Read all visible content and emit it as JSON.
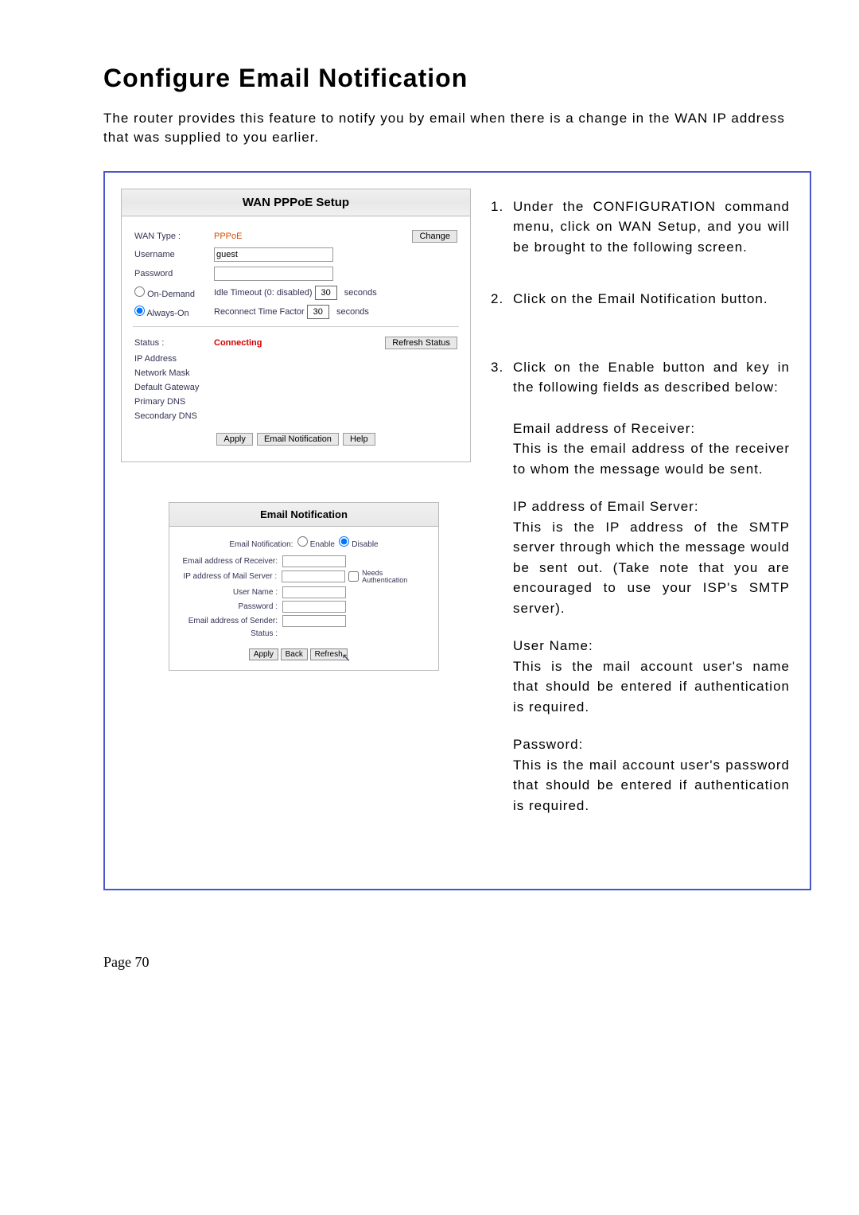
{
  "title": "Configure Email Notification",
  "intro": "The router provides this feature to notify you by email when there is a change in the WAN IP address that was supplied to you earlier.",
  "panelA": {
    "header": "WAN PPPoE Setup",
    "wanTypeLabel": "WAN Type :",
    "wanTypeValue": "PPPoE",
    "changeBtn": "Change",
    "usernameLabel": "Username",
    "usernameValue": "guest",
    "passwordLabel": "Password",
    "passwordValue": "",
    "onDemandLabel": "On-Demand",
    "alwaysOnLabel": "Always-On",
    "idleTimeoutLabel": "Idle Timeout (0: disabled)",
    "idleTimeoutValue": "30",
    "reconnectLabel": "Reconnect Time Factor",
    "reconnectValue": "30",
    "secondsLabel": "seconds",
    "statusLabel": "Status :",
    "statusValue": "Connecting",
    "refreshStatusBtn": "Refresh Status",
    "ipAddrLabel": "IP Address",
    "netmaskLabel": "Network Mask",
    "gatewayLabel": "Default Gateway",
    "primaryDnsLabel": "Primary DNS",
    "secondaryDnsLabel": "Secondary DNS",
    "applyBtn": "Apply",
    "emailNotifBtn": "Email Notification",
    "helpBtn": "Help"
  },
  "panelB": {
    "header": "Email Notification",
    "enableLabel": "Email Notification:",
    "optEnable": "Enable",
    "optDisable": "Disable",
    "receiverLabel": "Email address of Receiver:",
    "mailServerLabel": "IP address of Mail Server :",
    "needsAuthLabel": "Needs Authentication",
    "userNameLabel": "User Name :",
    "passwordLabel": "Password :",
    "senderLabel": "Email address of Sender:",
    "statusLabel": "Status :",
    "applyBtn": "Apply",
    "backBtn": "Back",
    "refreshBtn": "Refresh"
  },
  "steps": {
    "s1": "Under the CONFIGURATION command menu, click on WAN Setup, and you will be brought to the following screen.",
    "s2": "Click on the Email Notification button.",
    "s3intro": "Click on the Enable button and key in the following fields as described below:",
    "s3a_t": "Email address of Receiver:",
    "s3a_b": "This is the email address of the receiver to whom the message would be sent.",
    "s3b_t": "IP address of Email Server:",
    "s3b_b": "This is the IP address of the SMTP server through which the message would be sent out. (Take note that you are encouraged to use your ISP's SMTP server).",
    "s3c_t": "User Name:",
    "s3c_b": "This is the mail account user's name that should be entered if authentication is required.",
    "s3d_t": "Password:",
    "s3d_b": "This is the mail account user's password that should be entered if authentication is required."
  },
  "footer": "Page 70"
}
